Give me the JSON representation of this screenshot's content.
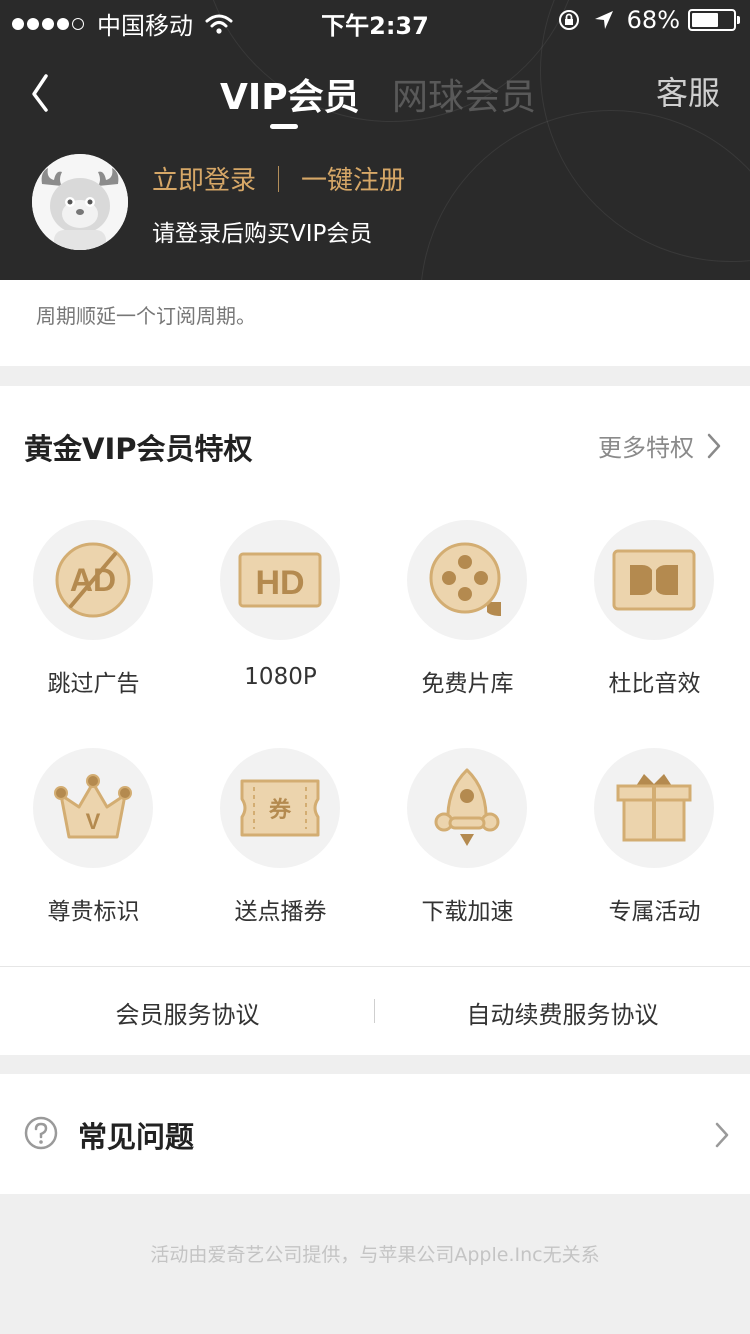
{
  "status_bar": {
    "carrier": "中国移动",
    "time": "下午2:37",
    "battery": "68%",
    "battery_level": 0.68
  },
  "nav": {
    "tab_vip": "VIP会员",
    "tab_tennis": "网球会员",
    "service": "客服"
  },
  "profile": {
    "login": "立即登录",
    "register": "一键注册",
    "hint": "请登录后购买VIP会员"
  },
  "notice": "周期顺延一个订阅周期。",
  "privileges": {
    "title": "黄金VIP会员特权",
    "more": "更多特权",
    "items": [
      {
        "label": "跳过广告",
        "icon": "ad-skip-icon"
      },
      {
        "label": "1080P",
        "icon": "hd-icon"
      },
      {
        "label": "免费片库",
        "icon": "film-reel-icon"
      },
      {
        "label": "杜比音效",
        "icon": "dolby-icon"
      },
      {
        "label": "尊贵标识",
        "icon": "crown-icon"
      },
      {
        "label": "送点播券",
        "icon": "ticket-icon"
      },
      {
        "label": "下载加速",
        "icon": "rocket-icon"
      },
      {
        "label": "专属活动",
        "icon": "gift-icon"
      }
    ],
    "icon_text": {
      "ad": "AD",
      "hd": "HD",
      "ticket": "券",
      "crown": "V"
    }
  },
  "agreements": {
    "member": "会员服务协议",
    "auto_renew": "自动续费服务协议"
  },
  "faq": {
    "title": "常见问题"
  },
  "footer": "活动由爱奇艺公司提供，与苹果公司Apple.Inc无关系",
  "colors": {
    "gold": "#d6a767",
    "icon_fill": "#ecd4ad",
    "icon_stroke": "#c49a5c",
    "header_bg": "#2a2a2a"
  }
}
